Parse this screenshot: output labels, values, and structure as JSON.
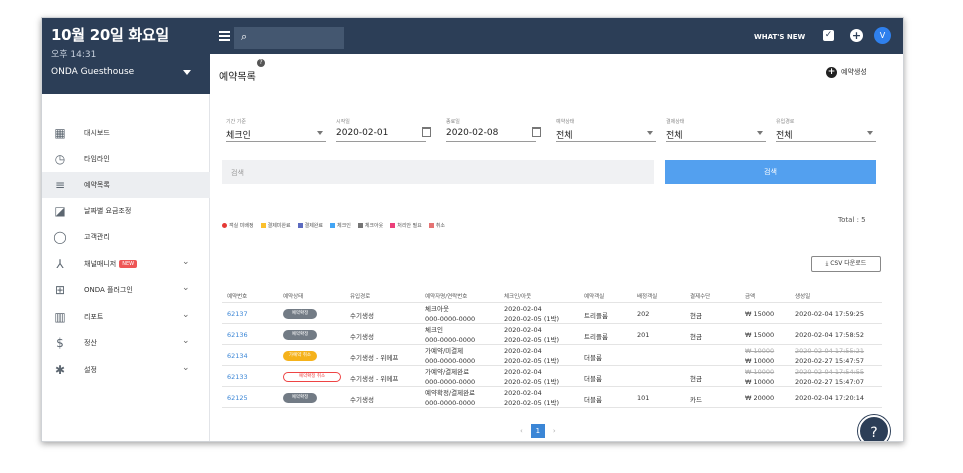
{
  "sidebar": {
    "date": "10월 20일 화요일",
    "time": "오후 14:31",
    "property": "ONDA Guesthouse",
    "items": [
      {
        "label": "대시보드",
        "icon": "dashboard-icon"
      },
      {
        "label": "타임라인",
        "icon": "clock-icon"
      },
      {
        "label": "예약목록",
        "icon": "list-check-icon"
      },
      {
        "label": "날짜별 요금조정",
        "icon": "calendar-edit-icon"
      },
      {
        "label": "고객관리",
        "icon": "face-icon"
      },
      {
        "label": "채널매니저",
        "icon": "channel-icon",
        "badge": "NEW"
      },
      {
        "label": "ONDA 플러그인",
        "icon": "plugin-icon"
      },
      {
        "label": "리포트",
        "icon": "chart-icon"
      },
      {
        "label": "정산",
        "icon": "dollar-icon"
      },
      {
        "label": "설정",
        "icon": "gear-icon"
      }
    ]
  },
  "topbar": {
    "whats_new": "WHAT'S NEW",
    "avatar": "V"
  },
  "page": {
    "title": "예약목록",
    "new_reservation": "예약생성",
    "help": "?"
  },
  "filters": {
    "period_caption": "기간 기준",
    "period": "체크인",
    "start_caption": "시작일",
    "start": "2020-02-01",
    "end_caption": "종료일",
    "end": "2020-02-08",
    "status_caption": "예약상태",
    "status": "전체",
    "payment_caption": "결제상태",
    "payment": "전체",
    "channel_caption": "유입경로",
    "channel": "전체"
  },
  "search": {
    "placeholder": "검색",
    "button": "검색"
  },
  "legend": [
    {
      "label": "객실 미배정",
      "color": "#e53935"
    },
    {
      "label": "결제미완료",
      "color": "#fbc02d"
    },
    {
      "label": "결제완료",
      "color": "#5c6bc0"
    },
    {
      "label": "체크인",
      "color": "#42a5f5"
    },
    {
      "label": "체크아웃",
      "color": "#757575"
    },
    {
      "label": "처리안 필요",
      "color": "#ec407a"
    },
    {
      "label": "취소",
      "color": "#e57373"
    }
  ],
  "total": "Total : 5",
  "csv_button": "CSV 다운로드",
  "table": {
    "headers": [
      "예약번호",
      "예약상태",
      "유입경로",
      "예약자명/연락번호",
      "체크인/아웃",
      "예약객실",
      "배정객실",
      "결제수단",
      "금액",
      "생성일"
    ],
    "rows": [
      {
        "id": "62137",
        "status": "예약확정",
        "status_kind": "ok",
        "channel": "수기생성",
        "name": "체크아웃",
        "phone": "000-0000-0000",
        "in": "2020-02-04",
        "out": "2020-02-05 (1박)",
        "room": "트리플룸",
        "assigned": "202",
        "pay": "현금",
        "amount": "₩ 15000",
        "amount_old": "",
        "created": "2020-02-04 17:59:25",
        "created_old": ""
      },
      {
        "id": "62136",
        "status": "예약확정",
        "status_kind": "ok",
        "channel": "수기생성",
        "name": "체크인",
        "phone": "000-0000-0000",
        "in": "2020-02-04",
        "out": "2020-02-05 (1박)",
        "room": "트리플룸",
        "assigned": "201",
        "pay": "현금",
        "amount": "₩ 15000",
        "amount_old": "",
        "created": "2020-02-04 17:58:52",
        "created_old": ""
      },
      {
        "id": "62134",
        "status": "가예약 취소",
        "status_kind": "pend",
        "channel": "수기생성 - 위메프",
        "name": "가예약/미결제",
        "phone": "000-0000-0000",
        "in": "2020-02-04",
        "out": "2020-02-05 (1박)",
        "room": "더블룸",
        "assigned": "",
        "pay": "",
        "amount": "₩ 10000",
        "amount_old": "₩ 10000",
        "created": "2020-02-27 15:47:57",
        "created_old": "2020-02-04 17:55:21"
      },
      {
        "id": "62133",
        "status": "예약확정 취소",
        "status_kind": "cx",
        "channel": "수기생성 - 위메프",
        "name": "가예약/결제완료",
        "phone": "000-0000-0000",
        "in": "2020-02-04",
        "out": "2020-02-05 (1박)",
        "room": "더블룸",
        "assigned": "",
        "pay": "현금",
        "amount": "₩ 10000",
        "amount_old": "₩ 10000",
        "created": "2020-02-27 15:47:07",
        "created_old": "2020-02-04 17:54:55"
      },
      {
        "id": "62125",
        "status": "예약확정",
        "status_kind": "ok",
        "channel": "수기생성",
        "name": "예약확정/결제완료",
        "phone": "000-0000-0000",
        "in": "2020-02-04",
        "out": "2020-02-05 (1박)",
        "room": "더블룸",
        "assigned": "101",
        "pay": "카드",
        "amount": "₩ 20000",
        "amount_old": "",
        "created": "2020-02-04 17:20:14",
        "created_old": ""
      }
    ]
  },
  "pager": {
    "prev": "‹",
    "page": "1",
    "next": "›"
  }
}
